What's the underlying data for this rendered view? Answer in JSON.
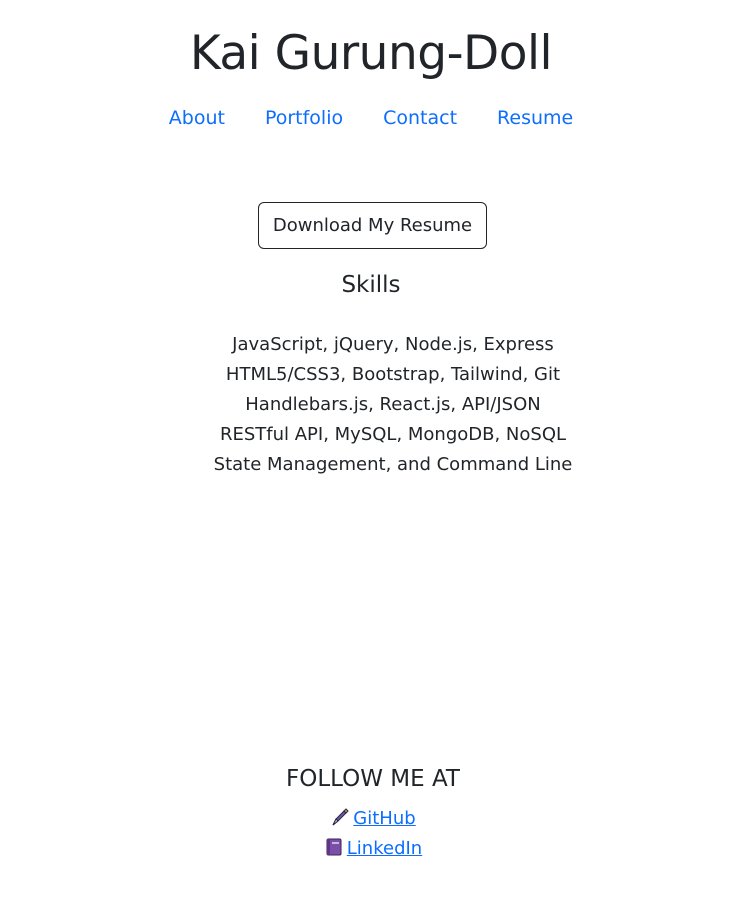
{
  "header": {
    "title": "Kai Gurung-Doll",
    "nav": [
      "About",
      "Portfolio",
      "Contact",
      "Resume"
    ]
  },
  "resume": {
    "download_label": "Download My Resume",
    "skills_heading": "Skills",
    "skills": [
      "JavaScript, jQuery, Node.js, Express",
      "HTML5/CSS3, Bootstrap, Tailwind, Git",
      "Handlebars.js, React.js, API/JSON",
      "RESTful API, MySQL, MongoDB, NoSQL",
      "State Management, and Command Line"
    ]
  },
  "footer": {
    "heading": "FOLLOW ME AT",
    "links": [
      {
        "label": "GitHub",
        "icon": "fountain-pen-icon"
      },
      {
        "label": "LinkedIn",
        "icon": "purple-book-icon"
      }
    ]
  },
  "colors": {
    "link": "#0d6efd",
    "text": "#212529"
  }
}
